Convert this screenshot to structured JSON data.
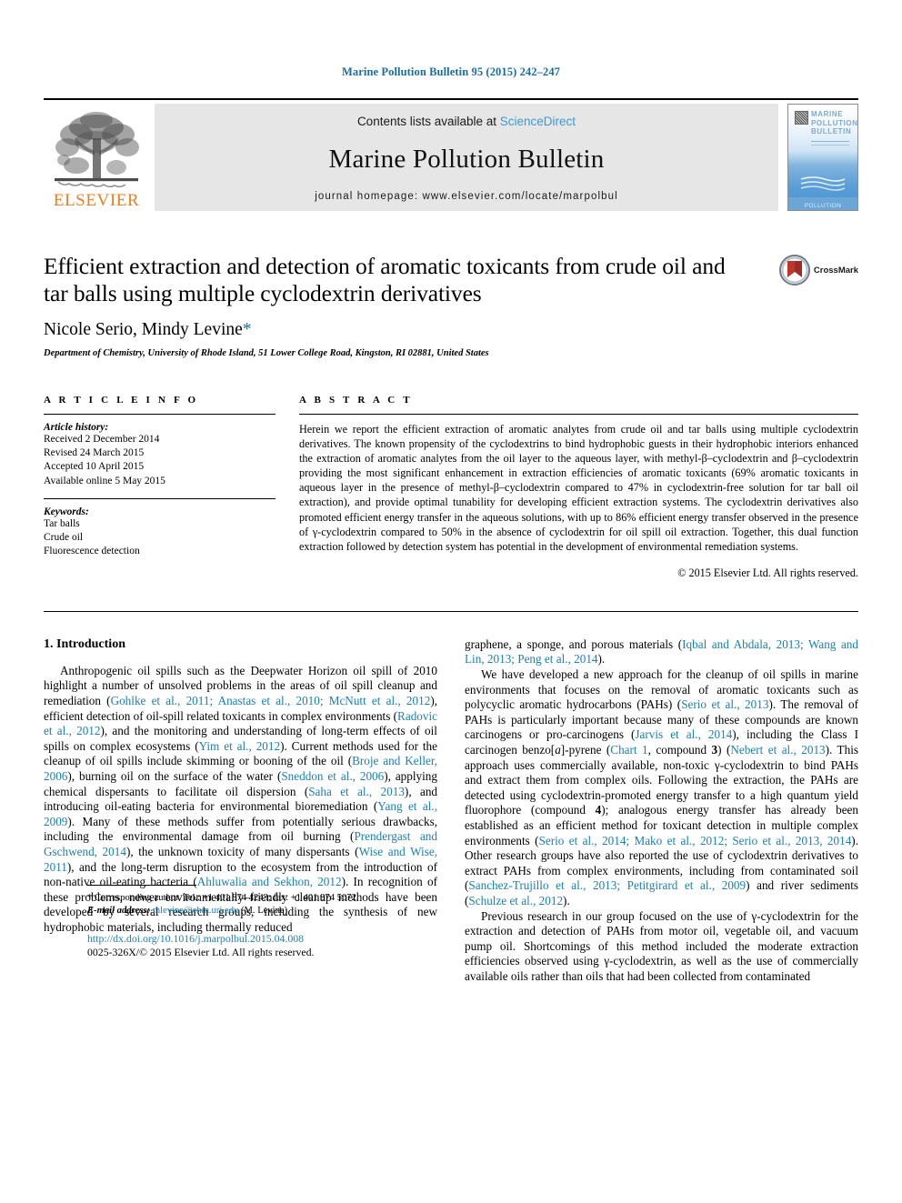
{
  "running_head": "Marine Pollution Bulletin 95 (2015) 242–247",
  "masthead": {
    "publisher": "ELSEVIER",
    "contents_prefix": "Contents lists available at ",
    "sciencedirect": "ScienceDirect",
    "journal_title": "Marine Pollution Bulletin",
    "homepage": "journal homepage: www.elsevier.com/locate/marpolbul",
    "cover_title": "MARINE POLLUTION BULLETIN",
    "cover_band_text": "POLLUTION"
  },
  "title": "Efficient extraction and detection of aromatic toxicants from crude oil and tar balls using multiple cyclodextrin derivatives",
  "authors": "Nicole Serio, Mindy Levine",
  "author_star": "*",
  "affiliation": "Department of Chemistry, University of Rhode Island, 51 Lower College Road, Kingston, RI 02881, United States",
  "crossmark_label": "CrossMark",
  "article_info": {
    "heading": "A R T I C L E   I N F O",
    "history_label": "Article history:",
    "history": [
      "Received 2 December 2014",
      "Revised 24 March 2015",
      "Accepted 10 April 2015",
      "Available online 5 May 2015"
    ],
    "keywords_label": "Keywords:",
    "keywords": [
      "Tar balls",
      "Crude oil",
      "Fluorescence detection"
    ]
  },
  "abstract": {
    "heading": "A B S T R A C T",
    "text": "Herein we report the efficient extraction of aromatic analytes from crude oil and tar balls using multiple cyclodextrin derivatives. The known propensity of the cyclodextrins to bind hydrophobic guests in their hydrophobic interiors enhanced the extraction of aromatic analytes from the oil layer to the aqueous layer, with methyl-β–cyclodextrin and β–cyclodextrin providing the most significant enhancement in extraction efficiencies of aromatic toxicants (69% aromatic toxicants in aqueous layer in the presence of methyl-β–cyclodextrin compared to 47% in cyclodextrin-free solution for tar ball oil extraction), and provide optimal tunability for developing efficient extraction systems. The cyclodextrin derivatives also promoted efficient energy transfer in the aqueous solutions, with up to 86% efficient energy transfer observed in the presence of γ-cyclodextrin compared to 50% in the absence of cyclodextrin for oil spill oil extraction. Together, this dual function extraction followed by detection system has potential in the development of environmental remediation systems.",
    "copyright": "© 2015 Elsevier Ltd. All rights reserved."
  },
  "section": {
    "number_title": "1. Introduction"
  },
  "footnote": {
    "corresponding": "* Corresponding author. Tel.: +1 401 874 4243; fax: +1 401 874 5072.",
    "email_label": "E-mail address:",
    "email": "mlevine@chm.uri.edu",
    "email_suffix": "(M. Levine).",
    "doi": "http://dx.doi.org/10.1016/j.marpolbul.2015.04.008",
    "issn": "0025-326X/© 2015 Elsevier Ltd. All rights reserved."
  },
  "colors": {
    "link": "#1a7fb5",
    "running_head": "#1a6ca5",
    "elsevier_orange": "#f47b20",
    "sciencedirect": "#3a9bd4"
  }
}
